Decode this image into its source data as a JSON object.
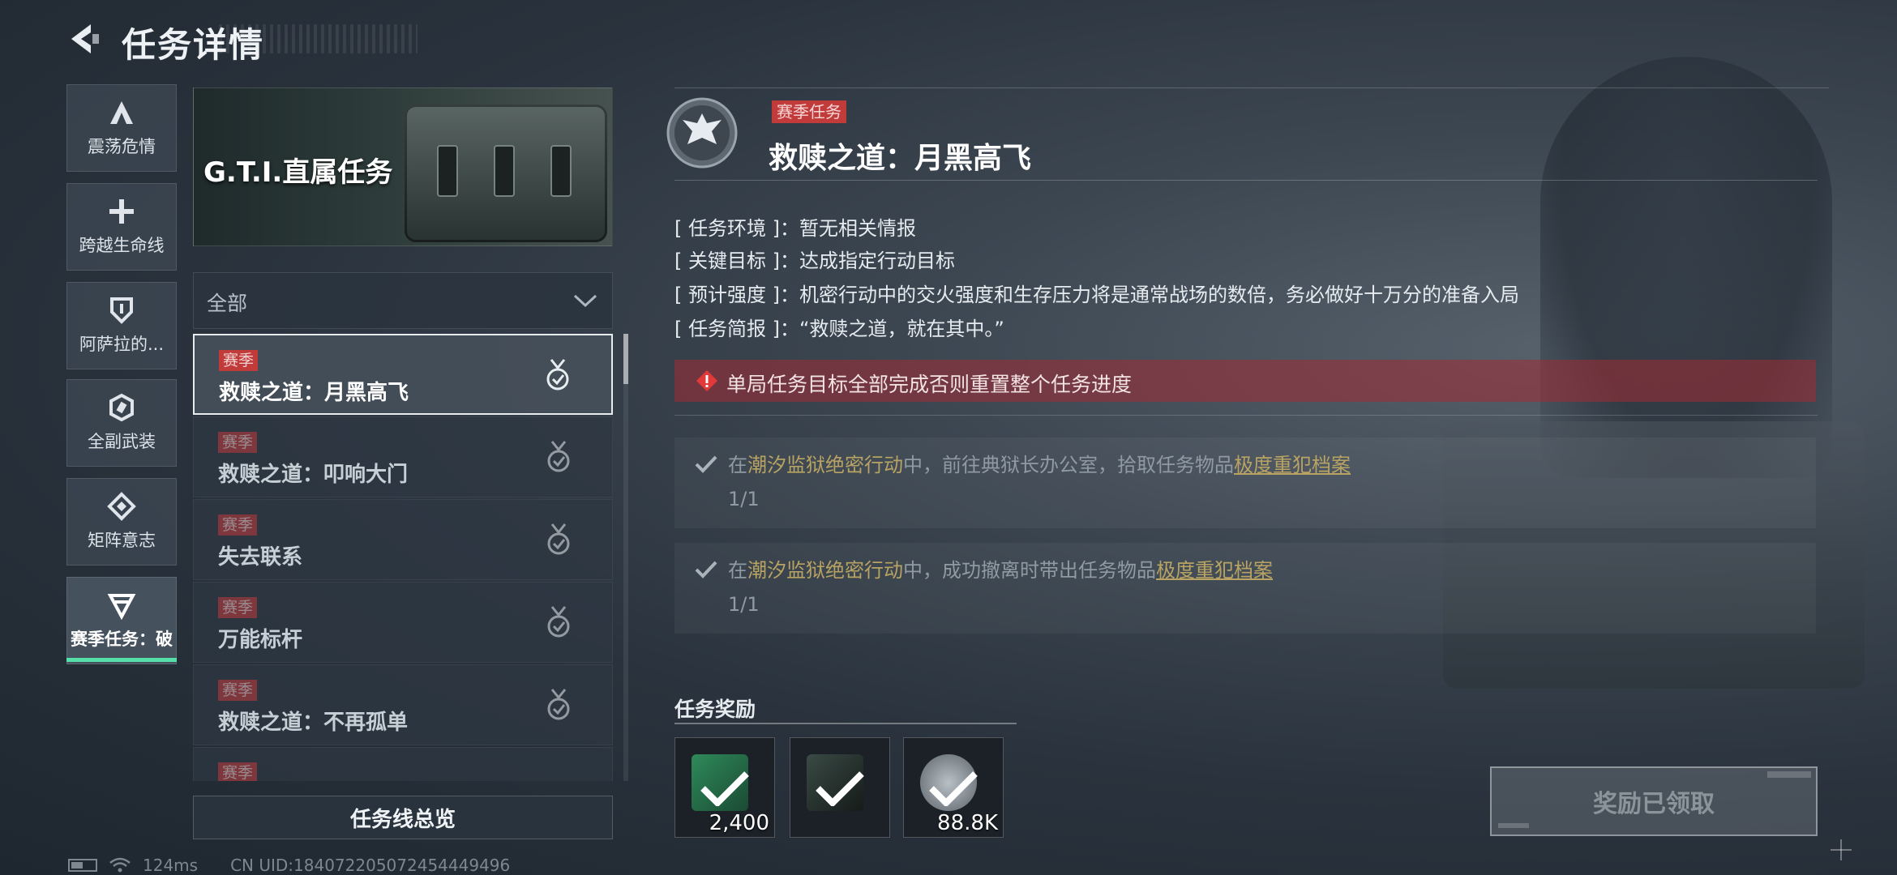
{
  "header": {
    "title": "任务详情"
  },
  "sidebar": {
    "items": [
      {
        "label": "震荡危情",
        "icon": "a-mark-icon"
      },
      {
        "label": "跨越生命线",
        "icon": "plus-cross-icon"
      },
      {
        "label": "阿萨拉的...",
        "icon": "shield-icon"
      },
      {
        "label": "全副武装",
        "icon": "hex-link-icon"
      },
      {
        "label": "矩阵意志",
        "icon": "diamond-arrows-icon"
      },
      {
        "label": "赛季任务：破",
        "icon": "triangle-icon",
        "active": true
      }
    ]
  },
  "banner": {
    "title": "G.T.I.直属任务"
  },
  "filter": {
    "selected": "全部"
  },
  "tasks": [
    {
      "tag": "赛季",
      "name": "救赎之道：月黑高飞",
      "selected": true
    },
    {
      "tag": "赛季",
      "name": "救赎之道：叩响大门"
    },
    {
      "tag": "赛季",
      "name": "失去联系"
    },
    {
      "tag": "赛季",
      "name": "万能标杆"
    },
    {
      "tag": "赛季",
      "name": "救赎之道：不再孤单"
    },
    {
      "tag": "赛季",
      "name": ""
    }
  ],
  "overview_button": "任务线总览",
  "detail": {
    "season_tag": "赛季任务",
    "title": "救赎之道：月黑高飞",
    "info": [
      {
        "key": "[ 任务环境 ]：",
        "value": "暂无相关情报"
      },
      {
        "key": "[ 关键目标 ]：",
        "value": "达成指定行动目标"
      },
      {
        "key": "[ 预计强度 ]：",
        "value": "机密行动中的交火强度和生存压力将是通常战场的数倍，务必做好十万分的准备入局"
      },
      {
        "key": "[ 任务简报 ]：",
        "value": "“救赎之道，就在其中。”"
      }
    ],
    "warning": "单局任务目标全部完成否则重置整个任务进度",
    "objectives": [
      {
        "pre": "在",
        "place": "潮汐监狱绝密行动",
        "mid": "中，前往典狱长办公室，拾取任务物品",
        "item": "极度重犯档案",
        "progress": "1/1"
      },
      {
        "pre": "在",
        "place": "潮汐监狱绝密行动",
        "mid": "中，成功撤离时带出任务物品",
        "item": "极度重犯档案",
        "progress": "1/1"
      }
    ],
    "rewards_title": "任务奖励",
    "rewards": [
      {
        "qty": "2,400",
        "icon": "green-card-icon"
      },
      {
        "qty": "",
        "icon": "dark-crate-icon"
      },
      {
        "qty": "88.8K",
        "icon": "silver-coin-icon"
      }
    ],
    "claim_button": "奖励已领取"
  },
  "status_bar": {
    "ping": "124ms",
    "uid": "CN UID:18407220507245444949​6"
  }
}
